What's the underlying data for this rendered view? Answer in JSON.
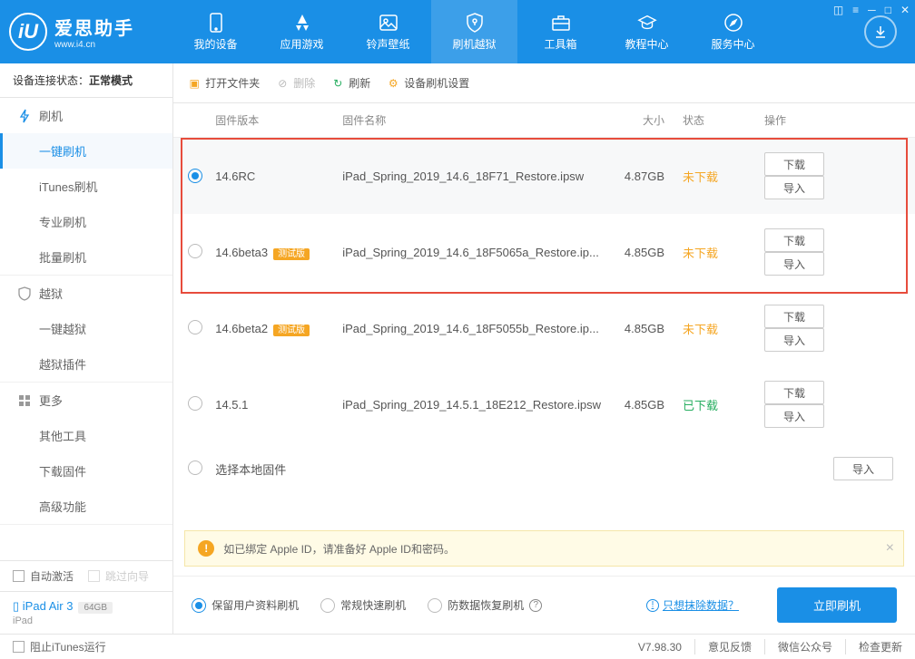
{
  "app": {
    "name": "爱思助手",
    "url": "www.i4.cn"
  },
  "nav": {
    "items": [
      "我的设备",
      "应用游戏",
      "铃声壁纸",
      "刷机越狱",
      "工具箱",
      "教程中心",
      "服务中心"
    ]
  },
  "sidebar": {
    "status_label": "设备连接状态：",
    "status_value": "正常模式",
    "groups": [
      {
        "title": "刷机",
        "items": [
          "一键刷机",
          "iTunes刷机",
          "专业刷机",
          "批量刷机"
        ]
      },
      {
        "title": "越狱",
        "items": [
          "一键越狱",
          "越狱插件"
        ]
      },
      {
        "title": "更多",
        "items": [
          "其他工具",
          "下载固件",
          "高级功能"
        ]
      }
    ],
    "auto_activate": "自动激活",
    "skip_guide": "跳过向导",
    "device_name": "iPad Air 3",
    "device_storage": "64GB",
    "device_type": "iPad"
  },
  "toolbar": {
    "open": "打开文件夹",
    "delete": "删除",
    "refresh": "刷新",
    "settings": "设备刷机设置"
  },
  "table": {
    "headers": {
      "version": "固件版本",
      "name": "固件名称",
      "size": "大小",
      "status": "状态",
      "ops": "操作"
    },
    "rows": [
      {
        "version": "14.6RC",
        "beta": false,
        "name": "iPad_Spring_2019_14.6_18F71_Restore.ipsw",
        "size": "4.87GB",
        "status": "未下载",
        "downloaded": false,
        "selected": true
      },
      {
        "version": "14.6beta3",
        "beta": true,
        "name": "iPad_Spring_2019_14.6_18F5065a_Restore.ip...",
        "size": "4.85GB",
        "status": "未下载",
        "downloaded": false,
        "selected": false
      },
      {
        "version": "14.6beta2",
        "beta": true,
        "name": "iPad_Spring_2019_14.6_18F5055b_Restore.ip...",
        "size": "4.85GB",
        "status": "未下载",
        "downloaded": false,
        "selected": false
      },
      {
        "version": "14.5.1",
        "beta": false,
        "name": "iPad_Spring_2019_14.5.1_18E212_Restore.ipsw",
        "size": "4.85GB",
        "status": "已下载",
        "downloaded": true,
        "selected": false
      }
    ],
    "local_firmware": "选择本地固件",
    "btn_download": "下载",
    "btn_import": "导入",
    "beta_badge": "测试版"
  },
  "warning": "如已绑定 Apple ID，请准备好 Apple ID和密码。",
  "options": {
    "opt1": "保留用户资料刷机",
    "opt2": "常规快速刷机",
    "opt3": "防数据恢复刷机",
    "erase_link": "只想抹除数据？",
    "flash_btn": "立即刷机"
  },
  "footer": {
    "block_itunes": "阻止iTunes运行",
    "version": "V7.98.30",
    "feedback": "意见反馈",
    "wechat": "微信公众号",
    "check_update": "检查更新"
  }
}
